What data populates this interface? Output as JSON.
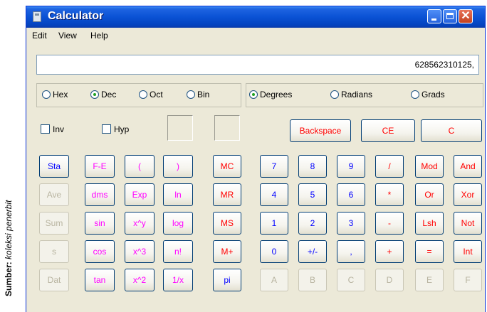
{
  "source_caption": {
    "bold": "Sumber:",
    "italic": "koleksi penerbit"
  },
  "window": {
    "title": "Calculator",
    "close_glyph": "✕"
  },
  "menu": [
    "Edit",
    "View",
    "Help"
  ],
  "display": {
    "value": "628562310125,"
  },
  "base_radios": [
    {
      "label": "Hex",
      "selected": false
    },
    {
      "label": "Dec",
      "selected": true
    },
    {
      "label": "Oct",
      "selected": false
    },
    {
      "label": "Bin",
      "selected": false
    }
  ],
  "angle_radios": [
    {
      "label": "Degrees",
      "selected": true
    },
    {
      "label": "Radians",
      "selected": false
    },
    {
      "label": "Grads",
      "selected": false
    }
  ],
  "checkboxes": [
    {
      "label": "Inv",
      "checked": false
    },
    {
      "label": "Hyp",
      "checked": false
    }
  ],
  "edit_buttons": [
    "Backspace",
    "CE",
    "C"
  ],
  "stat_buttons": [
    "Sta",
    "Ave",
    "Sum",
    "s",
    "Dat"
  ],
  "func_col1": [
    "F-E",
    "dms",
    "sin",
    "cos",
    "tan"
  ],
  "func_col2": [
    "(",
    "Exp",
    "x^y",
    "x^3",
    "x^2"
  ],
  "func_col3": [
    ")",
    "ln",
    "log",
    "n!",
    "1/x"
  ],
  "memory_buttons": [
    "MC",
    "MR",
    "MS",
    "M+",
    "pi"
  ],
  "keypad_rows": [
    [
      "7",
      "8",
      "9",
      "/",
      "Mod",
      "And"
    ],
    [
      "4",
      "5",
      "6",
      "*",
      "Or",
      "Xor"
    ],
    [
      "1",
      "2",
      "3",
      "-",
      "Lsh",
      "Not"
    ],
    [
      "0",
      "+/-",
      ",",
      "+",
      "=",
      "Int"
    ],
    [
      "A",
      "B",
      "C",
      "D",
      "E",
      "F"
    ]
  ],
  "colors": {
    "blue": "#0000ff",
    "red": "#ff0000",
    "magenta": "#ff00ff",
    "disabled": "#b8b4a0",
    "titlebar": "#0a52d4"
  }
}
